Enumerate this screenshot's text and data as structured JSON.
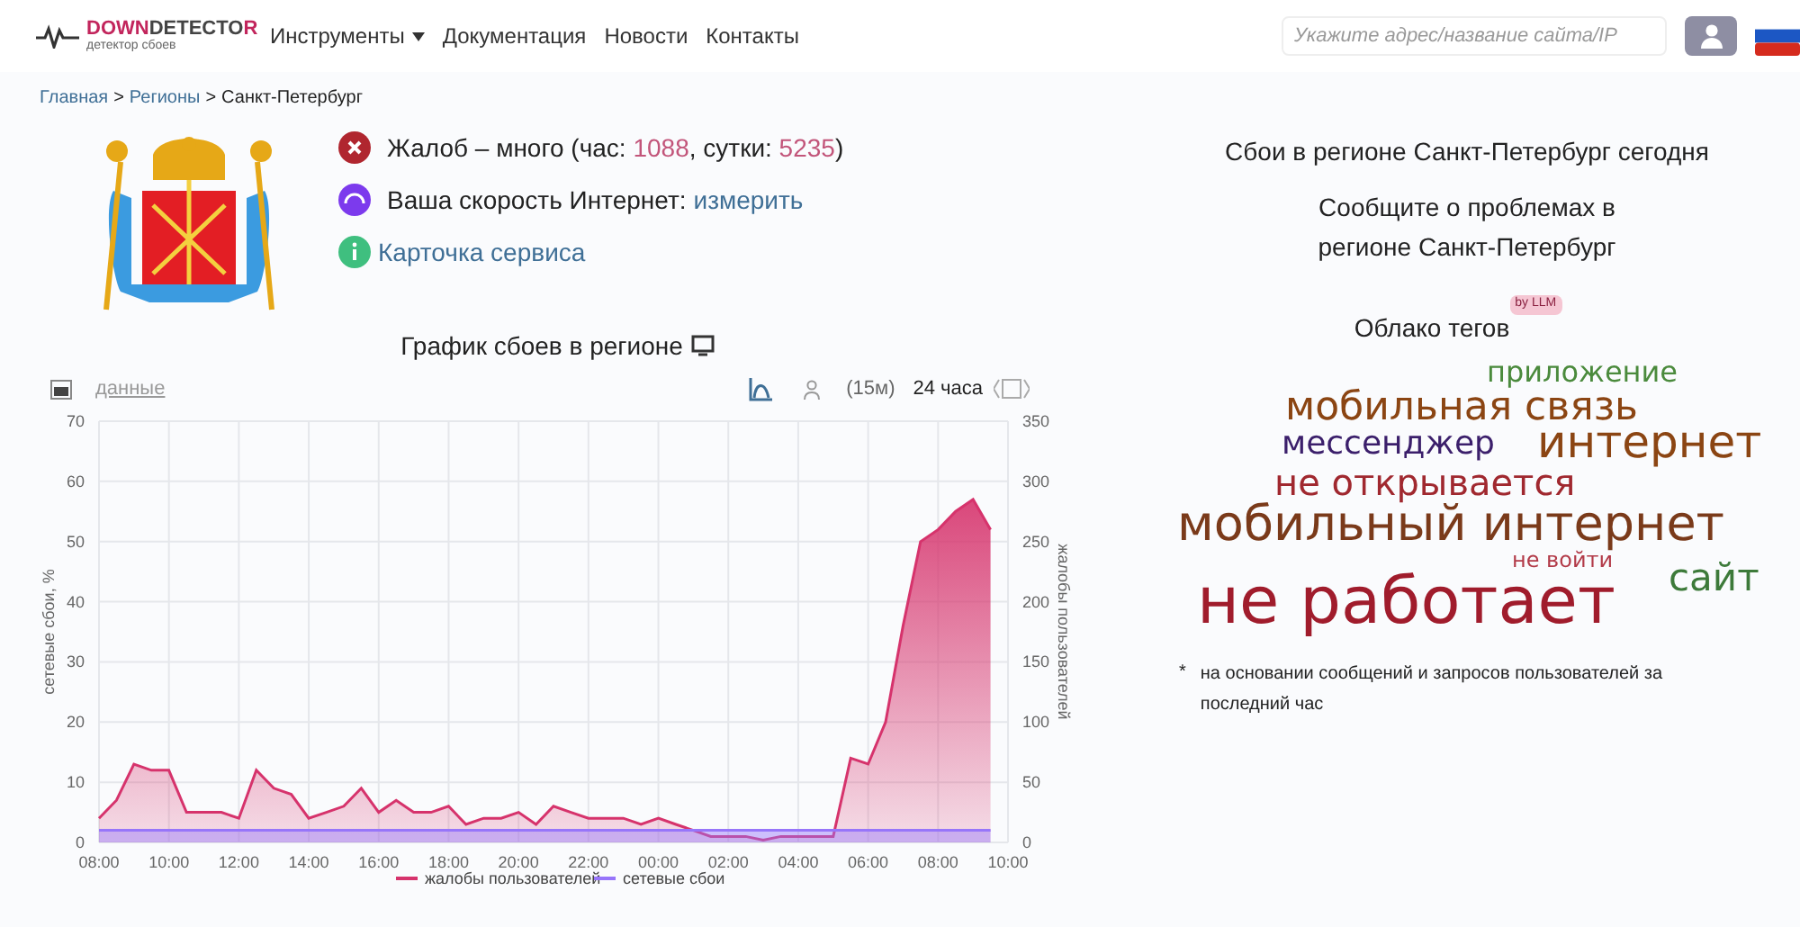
{
  "header": {
    "logo": {
      "title_a": "DOWN",
      "title_b": "DETECTO",
      "title_c": "R",
      "subtitle": "детектор сбоев"
    },
    "nav": [
      {
        "label": "Инструменты",
        "dropdown": true
      },
      {
        "label": "Документация",
        "dropdown": false
      },
      {
        "label": "Новости",
        "dropdown": false
      },
      {
        "label": "Контакты",
        "dropdown": false
      }
    ],
    "search": {
      "placeholder": "Укажите адрес/название сайта/IP"
    }
  },
  "breadcrumbs": [
    {
      "label": "Главная",
      "link": true
    },
    {
      "label": "Регионы",
      "link": true
    },
    {
      "label": "Санкт-Петербург",
      "link": false
    }
  ],
  "breadcrumb_separator": ">",
  "status": [
    {
      "kind": "alert",
      "text": "Жалоб – много (час: **1088**, сутки: **5235**)"
    },
    {
      "kind": "speed",
      "text": "Ваша скорость Интернет:",
      "link": "измерить"
    },
    {
      "kind": "info",
      "link": "Карточка сервиса"
    }
  ],
  "chart_title": "График сбоев в регионе",
  "chart_toolbar": {
    "data_link": "данные",
    "interval": "(15м)",
    "period": "24 часа"
  },
  "chart_data": {
    "type": "area",
    "ylabel": "сетевые сбои, %",
    "y2label": "жалобы пользователей",
    "categories": [
      "08:00",
      null,
      null,
      null,
      "10:00",
      null,
      null,
      null,
      "12:00",
      null,
      null,
      null,
      "14:00",
      null,
      null,
      null,
      "16:00",
      null,
      null,
      null,
      "18:00",
      null,
      null,
      null,
      "20:00",
      null,
      null,
      null,
      "22:00",
      null,
      null,
      null,
      "00:00",
      null,
      null,
      null,
      "02:00",
      null,
      null,
      null,
      "04:00",
      null,
      null,
      null,
      "06:00",
      null,
      null,
      null,
      "08:00",
      null,
      null,
      null,
      "10:00"
    ],
    "grid": true,
    "legend": true,
    "ylim": [
      0,
      70
    ],
    "yticks": [
      0,
      10,
      20,
      30,
      40,
      50,
      60,
      70
    ],
    "y2lim": [
      0,
      350
    ],
    "y2ticks": [
      0,
      50,
      100,
      150,
      200,
      250,
      300,
      350
    ],
    "series": [
      {
        "name": "жалобы пользователей",
        "color": "#d6336c",
        "axis": "y2",
        "values": [
          20,
          35,
          65,
          60,
          60,
          25,
          25,
          25,
          20,
          60,
          45,
          40,
          20,
          25,
          30,
          45,
          25,
          35,
          25,
          25,
          30,
          15,
          20,
          20,
          25,
          15,
          30,
          25,
          20,
          20,
          20,
          15,
          20,
          15,
          10,
          5,
          5,
          5,
          2,
          5,
          5,
          5,
          5,
          70,
          65,
          100,
          180,
          250,
          260,
          275,
          285,
          260,
          null
        ]
      },
      {
        "name": "сетевые сбои",
        "color": "#9775fa",
        "values": [
          2,
          2,
          2,
          2,
          2,
          2,
          2,
          2,
          2,
          2,
          2,
          2,
          2,
          2,
          2,
          2,
          2,
          2,
          2,
          2,
          2,
          2,
          2,
          2,
          2,
          2,
          2,
          2,
          2,
          2,
          2,
          2,
          2,
          2,
          2,
          2,
          2,
          2,
          2,
          2,
          2,
          2,
          2,
          2,
          2,
          2,
          2,
          2,
          2,
          2,
          2,
          2,
          null
        ]
      }
    ]
  },
  "side": {
    "title": "Сбои в регионе Санкт-Петербург сегодня",
    "report": "Сообщите о проблемах в регионе Санкт-Петербург",
    "cloud_title": "Облако тегов",
    "cloud_badge": "by LLM",
    "tags": [
      {
        "text": "приложение",
        "color": "#4a8a3c"
      },
      {
        "text": "мобильная связь",
        "color": "#8b4513"
      },
      {
        "text": "мессенджер",
        "color": "#3b1f6b"
      },
      {
        "text": "интернет",
        "color": "#8b4513"
      },
      {
        "text": "не открывается",
        "color": "#a0282f"
      },
      {
        "text": "мобильный интернет",
        "color": "#7a3a1a"
      },
      {
        "text": "не войти",
        "color": "#b23a48"
      },
      {
        "text": "не работает",
        "color": "#a01c2c"
      },
      {
        "text": "сайт",
        "color": "#3d7a3a"
      }
    ],
    "footnote_mark": "*",
    "footnote": "на основании сообщений и запросов пользователей за последний час"
  }
}
